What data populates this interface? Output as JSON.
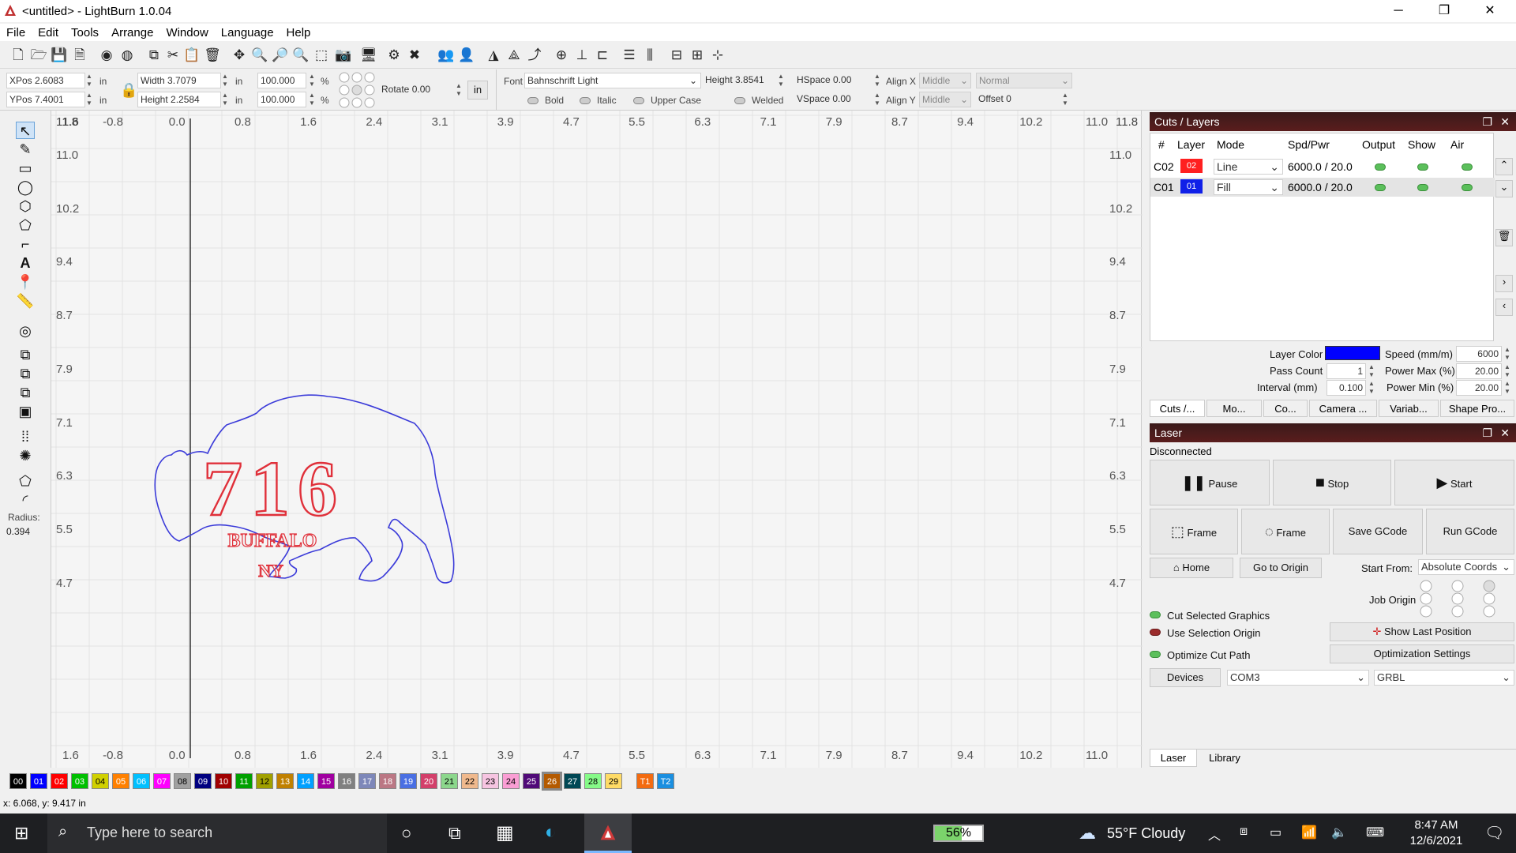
{
  "window": {
    "title": "<untitled> - LightBurn 1.0.04",
    "minimize": "─",
    "maximize": "❐",
    "close": "✕"
  },
  "menu": [
    "File",
    "Edit",
    "Tools",
    "Arrange",
    "Window",
    "Language",
    "Help"
  ],
  "numeric_bar": {
    "xpos_label": "XPos",
    "xpos": "2.6083",
    "ypos_label": "YPos",
    "ypos": "7.4001",
    "unit1": "in",
    "unit2": "in",
    "unit3": "in",
    "unit4": "in",
    "width_label": "Width",
    "width": "3.7079",
    "height_label": "Height",
    "height": "2.2584",
    "scale_x": "100.000",
    "scale_y": "100.000",
    "pct1": "%",
    "pct2": "%",
    "rotate_label": "Rotate",
    "rotate": "0.00",
    "units_button": "in",
    "font_label": "Font",
    "font_value": "Bahnschrift Light",
    "text_height_label": "Height",
    "text_height": "3.8541",
    "hspace_label": "HSpace",
    "hspace": "0.00",
    "vspace_label": "VSpace",
    "vspace": "0.00",
    "alignx_label": "Align X",
    "alignx": "Middle",
    "aligny_label": "Align Y",
    "aligny": "Middle",
    "style_value": "Normal",
    "offset_label": "Offset",
    "offset": "0",
    "bold": "Bold",
    "italic": "Italic",
    "upper": "Upper Case",
    "welded": "Welded"
  },
  "toolbox": {
    "radius_label": "Radius:",
    "radius_value": "0.394"
  },
  "ruler": {
    "x_ticks": [
      "1.6",
      "-0.8",
      "0.0",
      "0.8",
      "1.6",
      "2.4",
      "3.1",
      "3.9",
      "4.7",
      "5.5",
      "6.3",
      "7.1",
      "7.9",
      "8.7",
      "9.4",
      "10.2",
      "11.0"
    ],
    "top_left": "11.8",
    "top_right": "11.8",
    "y_ticks": [
      "11.0",
      "10.2",
      "9.4",
      "8.7",
      "7.9",
      "7.1",
      "6.3",
      "5.5",
      "4.7"
    ]
  },
  "artwork": {
    "number": "716",
    "line1": "BUFFALO",
    "line2": "NY",
    "outline_color": "#3b3bd9",
    "text_color": "#e0303a"
  },
  "cuts_panel": {
    "title": "Cuts / Layers",
    "columns": [
      "#",
      "Layer",
      "Mode",
      "Spd/Pwr",
      "Output",
      "Show",
      "Air"
    ],
    "rows": [
      {
        "id": "C02",
        "layer": "02",
        "color": "#ff2020",
        "mode": "Line",
        "spdpwr": "6000.0 / 20.0"
      },
      {
        "id": "C01",
        "layer": "01",
        "color": "#1020e8",
        "mode": "Fill",
        "spdpwr": "6000.0 / 20.0"
      }
    ],
    "layer_color_label": "Layer Color",
    "layer_color": "#0000ff",
    "pass_count_label": "Pass Count",
    "pass_count": "1",
    "interval_label": "Interval (mm)",
    "interval": "0.100",
    "speed_label": "Speed (mm/m)",
    "speed": "6000",
    "powermax_label": "Power Max (%)",
    "powermax": "20.00",
    "powermin_label": "Power Min (%)",
    "powermin": "20.00",
    "tabs": [
      "Cuts /...",
      "Mo...",
      "Co...",
      "Camera ...",
      "Variab...",
      "Shape Pro..."
    ]
  },
  "laser_panel": {
    "title": "Laser",
    "status": "Disconnected",
    "pause": "Pause",
    "stop": "Stop",
    "start": "Start",
    "frame1": "Frame",
    "frame2": "Frame",
    "save_gcode": "Save GCode",
    "run_gcode": "Run GCode",
    "home": "Home",
    "go_origin": "Go to Origin",
    "start_from_label": "Start From:",
    "start_from": "Absolute Coords",
    "job_origin_label": "Job Origin",
    "cut_selected": "Cut Selected Graphics",
    "use_selection": "Use Selection Origin",
    "optimize": "Optimize Cut Path",
    "show_last": "Show Last Position",
    "opt_settings": "Optimization Settings",
    "devices": "Devices",
    "port": "COM3",
    "controller": "GRBL",
    "tabs": [
      "Laser",
      "Library"
    ]
  },
  "palette": [
    {
      "label": "00",
      "color": "#000000"
    },
    {
      "label": "01",
      "color": "#0000ff"
    },
    {
      "label": "02",
      "color": "#ff0000"
    },
    {
      "label": "03",
      "color": "#00c000"
    },
    {
      "label": "04",
      "color": "#d0d000"
    },
    {
      "label": "05",
      "color": "#ff8000"
    },
    {
      "label": "06",
      "color": "#00c0ff"
    },
    {
      "label": "07",
      "color": "#ff00ff"
    },
    {
      "label": "08",
      "color": "#a0a0a0"
    },
    {
      "label": "09",
      "color": "#000080"
    },
    {
      "label": "10",
      "color": "#a00000"
    },
    {
      "label": "11",
      "color": "#00a000"
    },
    {
      "label": "12",
      "color": "#a0a000"
    },
    {
      "label": "13",
      "color": "#c08000"
    },
    {
      "label": "14",
      "color": "#00a0ff"
    },
    {
      "label": "15",
      "color": "#a000a0"
    },
    {
      "label": "16",
      "color": "#808080"
    },
    {
      "label": "17",
      "color": "#7d87b9"
    },
    {
      "label": "18",
      "color": "#bb7784"
    },
    {
      "label": "19",
      "color": "#4a6fe3"
    },
    {
      "label": "20",
      "color": "#d33f6a"
    },
    {
      "label": "21",
      "color": "#8cd78c"
    },
    {
      "label": "22",
      "color": "#f0b98d"
    },
    {
      "label": "23",
      "color": "#f6c4e1"
    },
    {
      "label": "24",
      "color": "#fa9ed4"
    },
    {
      "label": "25",
      "color": "#500a78"
    },
    {
      "label": "26",
      "color": "#b45a00"
    },
    {
      "label": "27",
      "color": "#004754"
    },
    {
      "label": "28",
      "color": "#86fa88"
    },
    {
      "label": "29",
      "color": "#ffdb66"
    },
    {
      "label": "T1",
      "color": "#f36b10"
    },
    {
      "label": "T2",
      "color": "#1a8fe0"
    }
  ],
  "status_bar": "x: 6.068, y: 9.417 in",
  "taskbar": {
    "search_placeholder": "Type here to search",
    "battery": "56%",
    "weather": "55°F Cloudy",
    "time": "8:47 AM",
    "date": "12/6/2021"
  }
}
